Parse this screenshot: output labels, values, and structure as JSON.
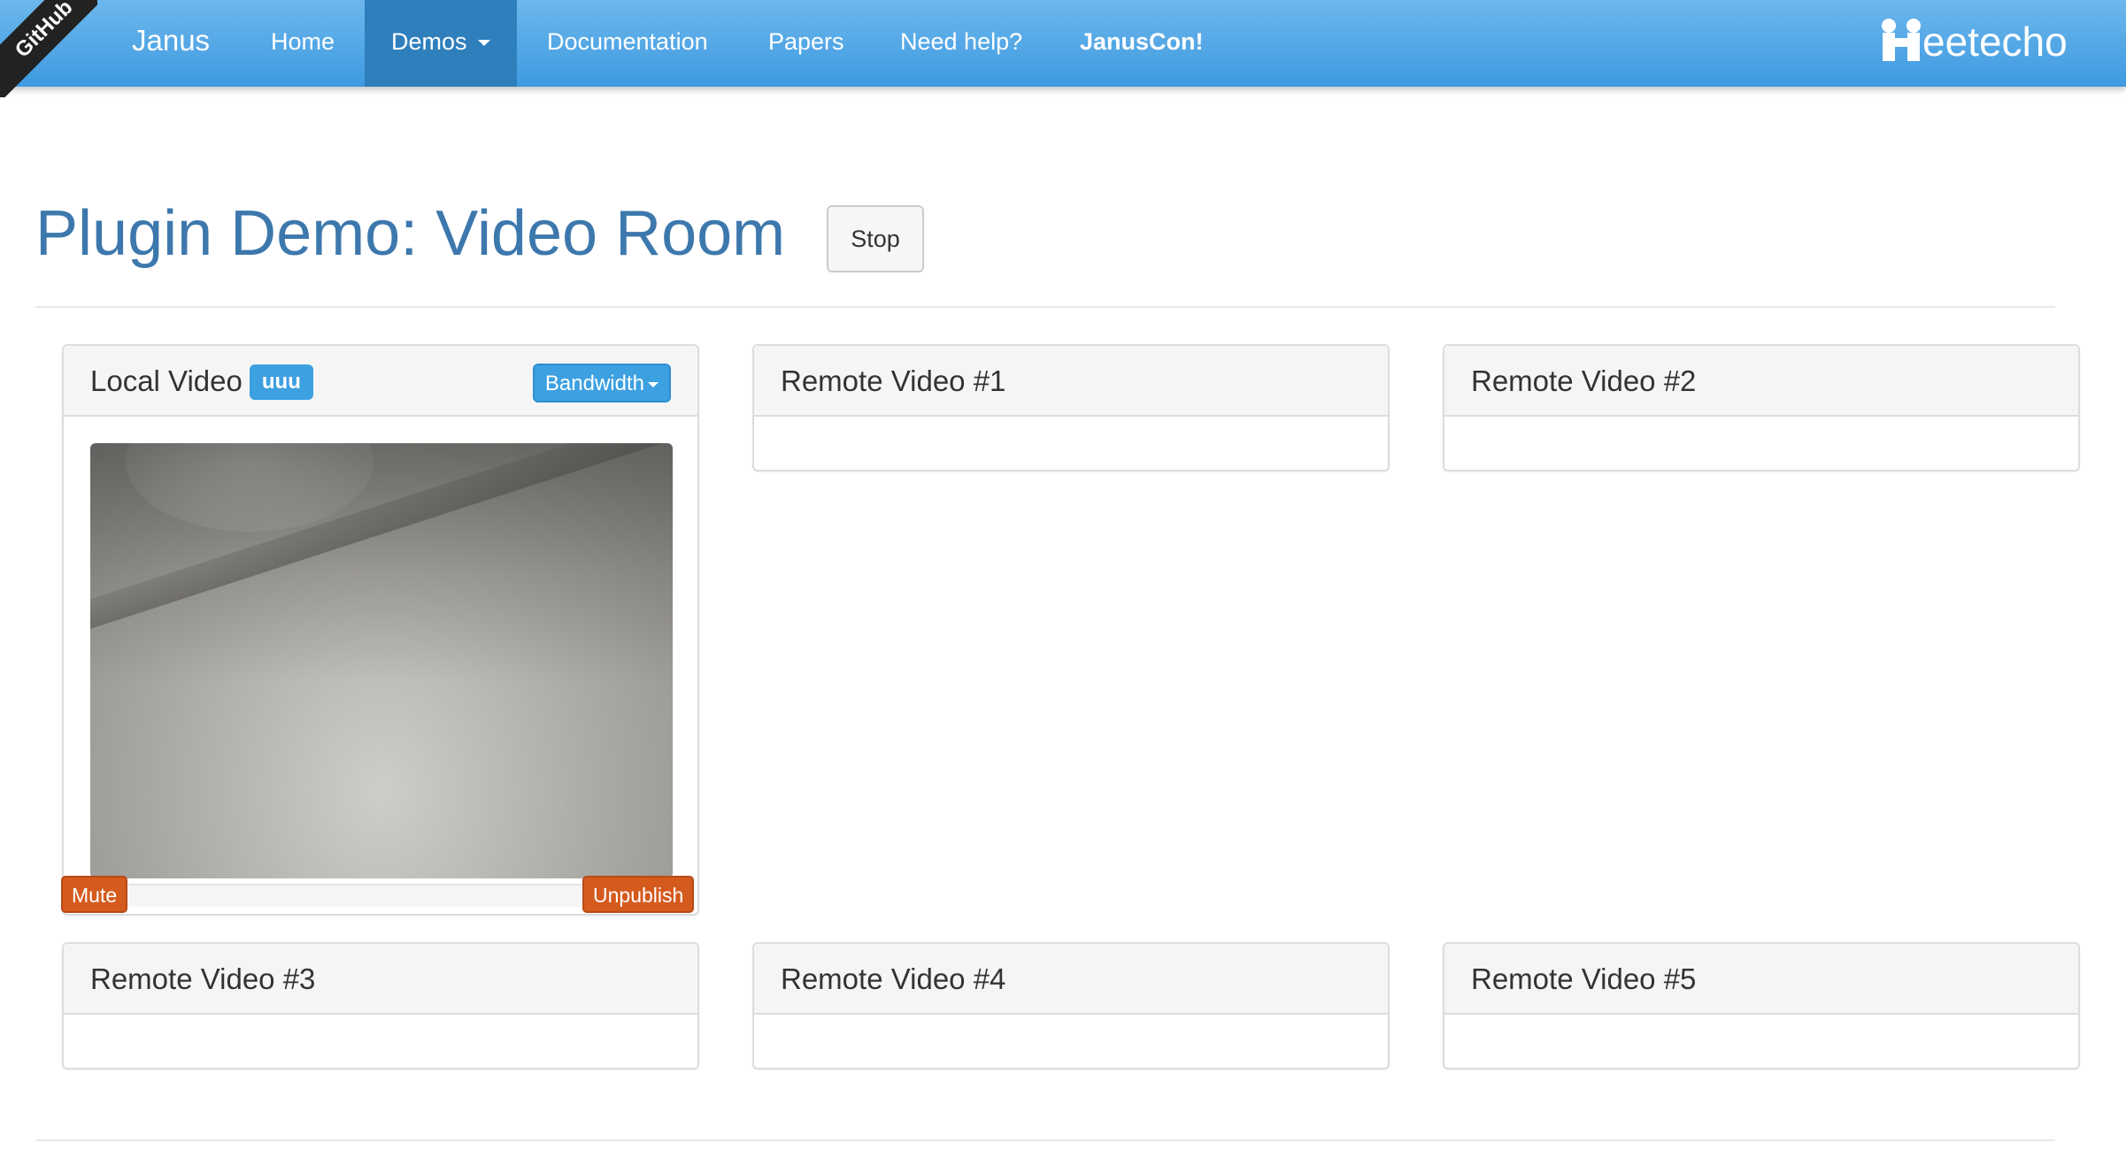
{
  "ribbon": {
    "text": "GitHub"
  },
  "nav": {
    "brand": "Janus",
    "items": [
      {
        "label": "Home"
      },
      {
        "label": "Demos"
      },
      {
        "label": "Documentation"
      },
      {
        "label": "Papers"
      },
      {
        "label": "Need help?"
      },
      {
        "label": "JanusCon!"
      }
    ],
    "logo_text": "eetecho"
  },
  "page": {
    "title": "Plugin Demo: Video Room",
    "stop_label": "Stop"
  },
  "local": {
    "title": "Local Video",
    "user_badge": "uuu",
    "bandwidth_label": "Bandwidth",
    "mute_label": "Mute",
    "unpublish_label": "Unpublish"
  },
  "remotes": [
    {
      "title": "Remote Video #1"
    },
    {
      "title": "Remote Video #2"
    },
    {
      "title": "Remote Video #3"
    },
    {
      "title": "Remote Video #4"
    },
    {
      "title": "Remote Video #5"
    }
  ],
  "colors": {
    "navbar": "#3f9ae0",
    "title": "#3d78ad",
    "badge": "#3da0e0",
    "danger": "#d45a1e"
  }
}
